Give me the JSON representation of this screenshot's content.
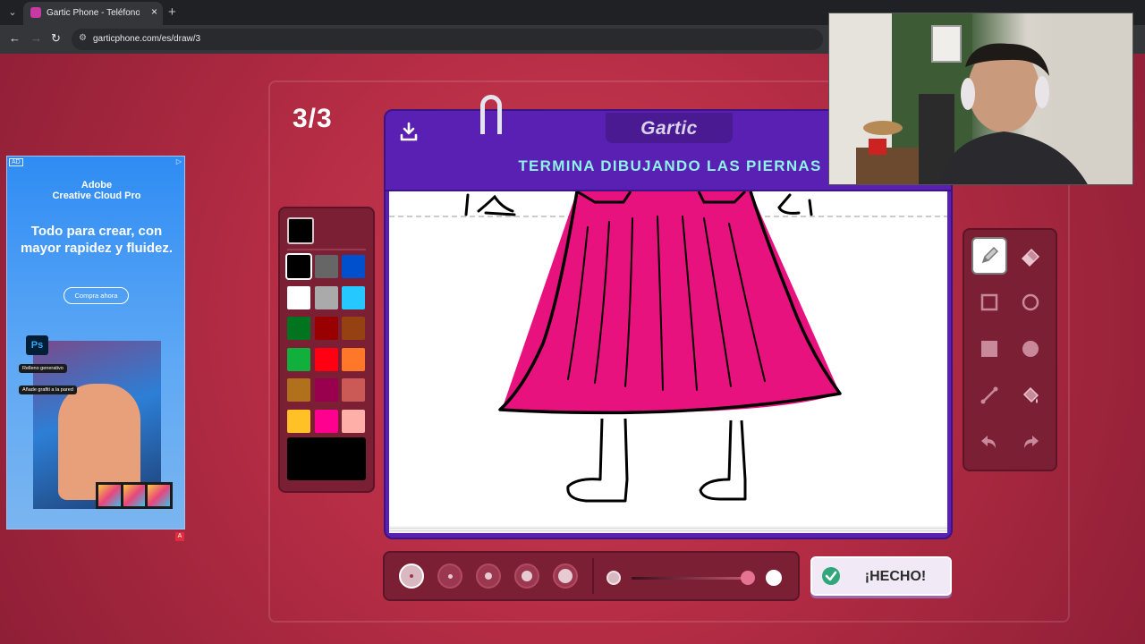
{
  "browser": {
    "tab_title": "Gartic Phone - Teléfono Descon",
    "url": "garticphone.com/es/draw/3"
  },
  "game": {
    "round": "3/3",
    "logo": "Gartic",
    "prompt": "TERMINA DIBUJANDO LAS PIERNAS",
    "done_label": "¡HECHO!",
    "selected_color": "#000000",
    "selected_tool": "pencil",
    "selected_brush_size": 1,
    "opacity": 0.8
  },
  "palette": {
    "colors": [
      [
        "#000000",
        "#666666",
        "#0050cd"
      ],
      [
        "#ffffff",
        "#aaaaaa",
        "#26c9ff"
      ],
      [
        "#017420",
        "#990000",
        "#964112"
      ],
      [
        "#11b03c",
        "#ff0013",
        "#ff7829"
      ],
      [
        "#b0701c",
        "#99004e",
        "#cb5a57"
      ],
      [
        "#ffc126",
        "#ff008f",
        "#feafa8"
      ]
    ]
  },
  "tools": [
    "pencil-icon",
    "eraser-icon",
    "rectangle-outline-icon",
    "circle-outline-icon",
    "rectangle-fill-icon",
    "circle-fill-icon",
    "line-icon",
    "bucket-fill-icon",
    "undo-icon",
    "redo-icon"
  ],
  "ad": {
    "badge": "AD",
    "brand_line1": "Adobe",
    "brand_line2": "Creative Cloud Pro",
    "headline": "Todo para crear, con mayor rapidez y fluidez.",
    "cta": "Compra ahora",
    "ps": "Ps",
    "chip1": "Relleno generativo",
    "chip2": "Añade grafiti a la pared"
  }
}
